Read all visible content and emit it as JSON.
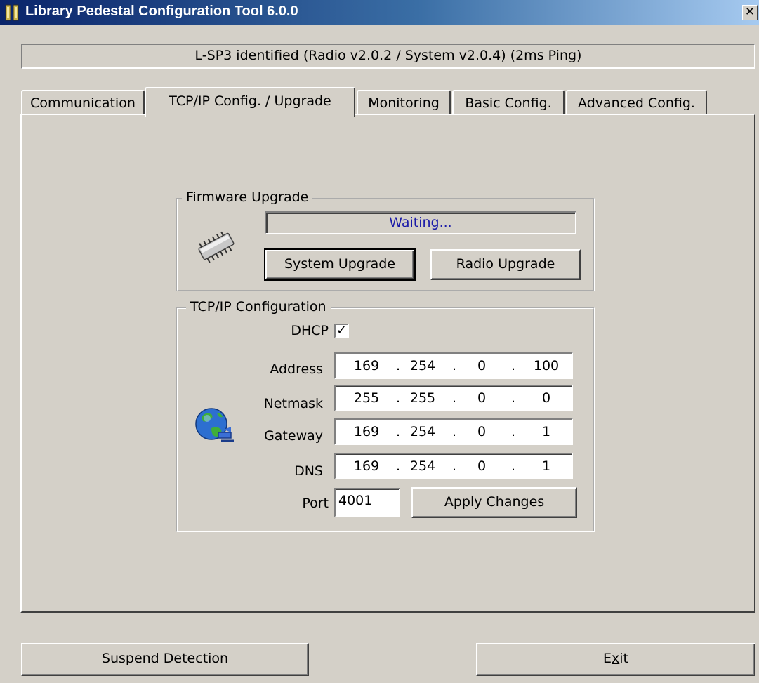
{
  "window": {
    "title": "Library Pedestal Configuration Tool 6.0.0",
    "close_glyph": "✕"
  },
  "status_text": "L-SP3 identified (Radio v2.0.2 / System v2.0.4) (2ms Ping)",
  "tabs": [
    {
      "label": "Communication",
      "active": false
    },
    {
      "label": "TCP/IP Config. / Upgrade",
      "active": true
    },
    {
      "label": "Monitoring",
      "active": false
    },
    {
      "label": "Basic Config.",
      "active": false
    },
    {
      "label": "Advanced Config.",
      "active": false
    }
  ],
  "firmware": {
    "legend": "Firmware Upgrade",
    "progress_text": "Waiting...",
    "progress_fraction": 0,
    "system_button": "System Upgrade",
    "radio_button": "Radio Upgrade",
    "icon": "chip-icon"
  },
  "tcpip": {
    "legend": "TCP/IP Configuration",
    "dhcp_label": "DHCP",
    "dhcp_checked": true,
    "dhcp_check_glyph": "✓",
    "icon": "globe-network-icon",
    "address_label": "Address",
    "address": [
      "169",
      "254",
      "0",
      "100"
    ],
    "netmask_label": "Netmask",
    "netmask": [
      "255",
      "255",
      "0",
      "0"
    ],
    "gateway_label": "Gateway",
    "gateway": [
      "169",
      "254",
      "0",
      "1"
    ],
    "dns_label": "DNS",
    "dns": [
      "169",
      "254",
      "0",
      "1"
    ],
    "port_label": "Port",
    "port": "4001",
    "apply_button": "Apply Changes"
  },
  "footer": {
    "suspend_button": "Suspend Detection",
    "exit_prefix": "E",
    "exit_mnemonic": "x",
    "exit_suffix": "it"
  },
  "colors": {
    "title_start": "#0a246a",
    "title_end": "#a6caf0",
    "face": "#d4d0c8",
    "progress_text": "#1a1aa8"
  }
}
